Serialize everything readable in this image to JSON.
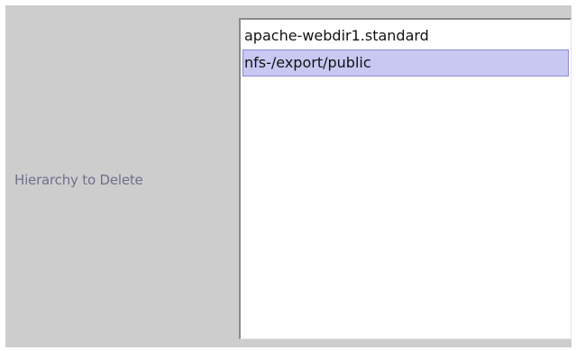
{
  "form": {
    "label": "Hierarchy to Delete"
  },
  "hierarchy_list": {
    "items": [
      {
        "label": "apache-webdir1.standard",
        "selected": false
      },
      {
        "label": "nfs-/export/public",
        "selected": true
      }
    ]
  },
  "colors": {
    "panel_background": "#cdcdcd",
    "label_text": "#6f6f8c",
    "selection_background": "#c8c8f2",
    "selection_border": "#8b8bcf"
  }
}
